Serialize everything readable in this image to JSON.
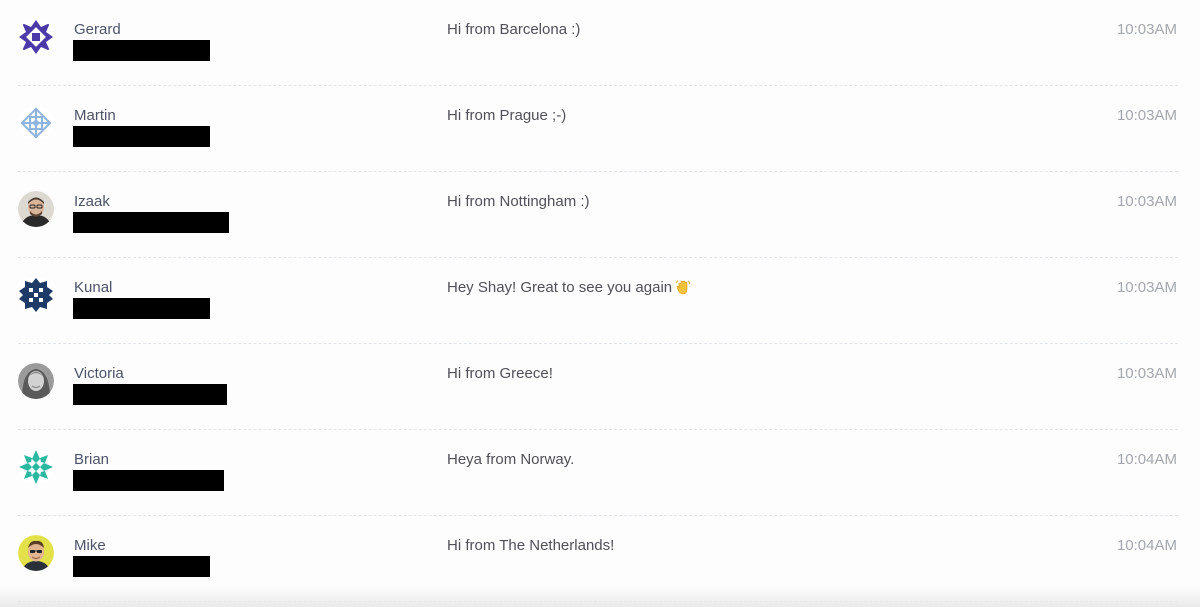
{
  "messages": [
    {
      "name": "Gerard",
      "text": "Hi from Barcelona :)",
      "time": "10:03AM",
      "avatar": "geometric-purple-icon",
      "color": "#4b3aa8"
    },
    {
      "name": "Martin",
      "text": "Hi from Prague ;-)",
      "time": "10:03AM",
      "avatar": "geometric-lightblue-icon",
      "color": "#8fb5de"
    },
    {
      "name": "Izaak",
      "text": "Hi from Nottingham :)",
      "time": "10:03AM",
      "avatar": "user-photo-icon",
      "color": "#6d6a66"
    },
    {
      "name": "Kunal",
      "text": "Hey Shay! Great to see you again",
      "emoji": "waving-hand-icon",
      "time": "10:03AM",
      "avatar": "geometric-navy-icon",
      "color": "#1d3b66"
    },
    {
      "name": "Victoria",
      "text": "Hi from Greece!",
      "time": "10:03AM",
      "avatar": "user-photo-icon",
      "color": "#8a8a8a"
    },
    {
      "name": "Brian",
      "text": "Heya from Norway.",
      "time": "10:04AM",
      "avatar": "geometric-teal-icon",
      "color": "#2bb8a0"
    },
    {
      "name": "Mike",
      "text": "Hi from The Netherlands!",
      "time": "10:04AM",
      "avatar": "user-photo-icon",
      "color": "#e3e14a"
    }
  ]
}
